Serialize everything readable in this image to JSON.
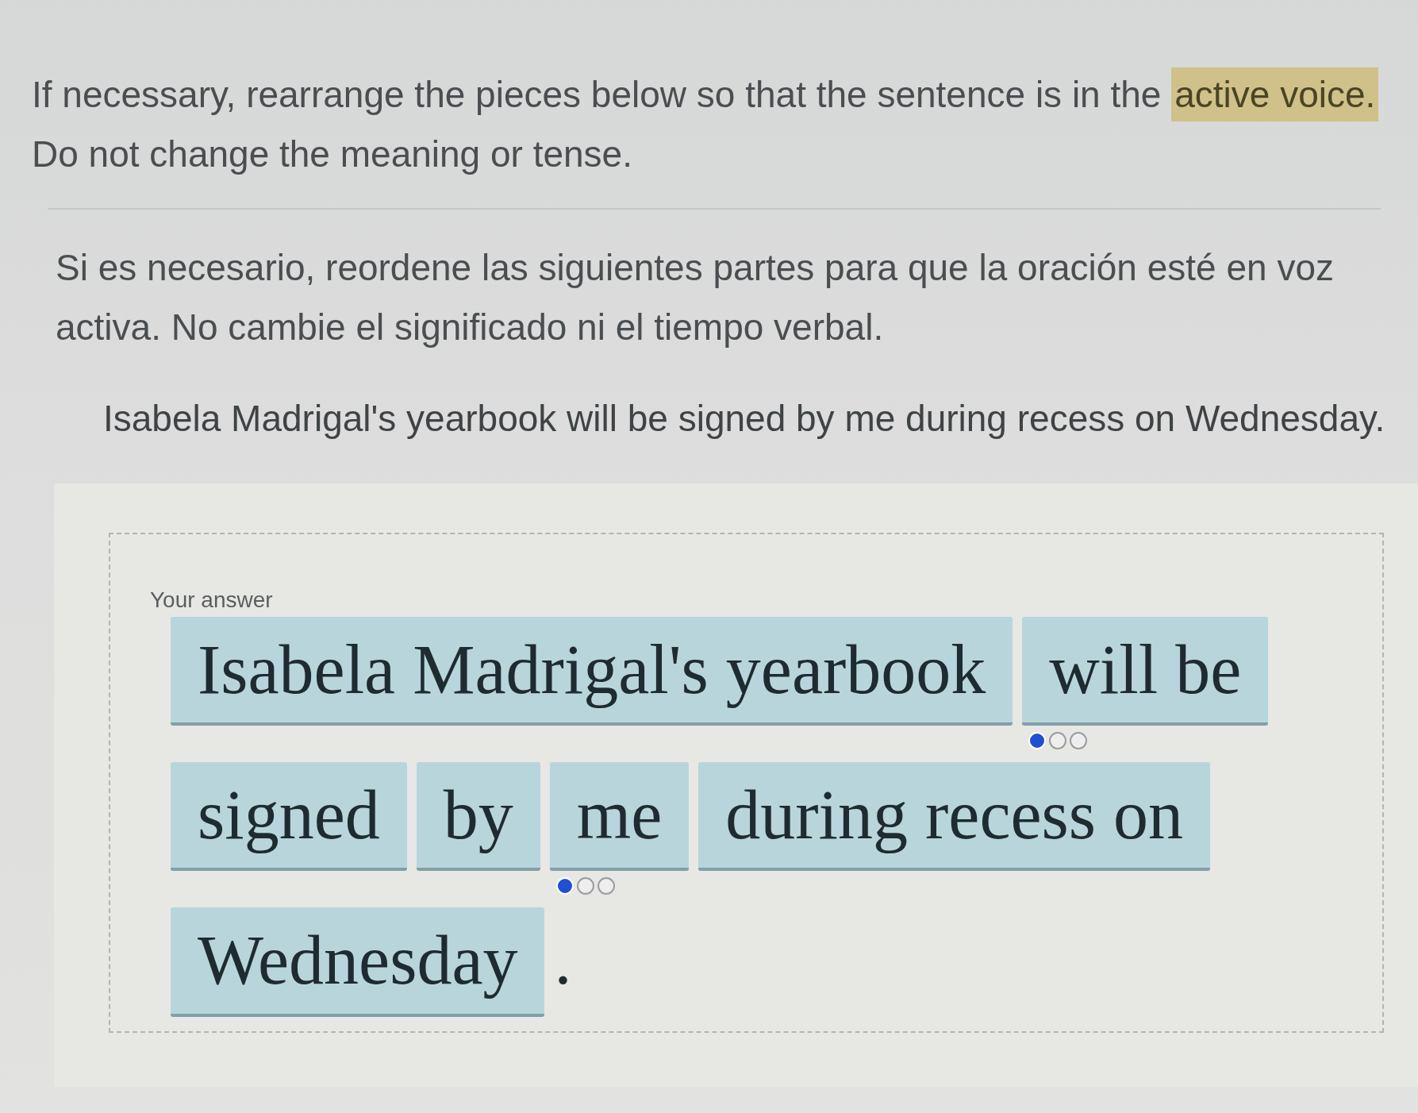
{
  "instructions_en": {
    "segments": [
      {
        "text": "If necessary, rearrange the pieces below so that the sentence is in the ",
        "highlighted": false
      },
      {
        "text": "active voice.",
        "highlighted": true
      },
      {
        "text": " Do not change the meaning or tense.",
        "highlighted": false
      }
    ]
  },
  "instructions_es": {
    "text": "Si es necesario, reordene las siguientes partes para que la oración esté en voz activa. No cambie el significado ni el tiempo verbal."
  },
  "sentence": "Isabela Madrigal's yearbook will be signed by me during recess on Wednesday.",
  "answer": {
    "label": "Your answer",
    "pieces": [
      {
        "kind": "tile",
        "text": "Isabela Madrigal's yearbook"
      },
      {
        "kind": "tile",
        "text": "will be",
        "dots": [
          {
            "selected": true
          },
          {
            "selected": false
          },
          {
            "selected": false
          }
        ]
      },
      {
        "kind": "tile",
        "text": "signed"
      },
      {
        "kind": "tile",
        "text": "by"
      },
      {
        "kind": "tile",
        "text": "me",
        "dots": [
          {
            "selected": true
          },
          {
            "selected": false
          },
          {
            "selected": false
          }
        ]
      },
      {
        "kind": "tile",
        "text": "during recess on"
      },
      {
        "kind": "tile",
        "text": "Wednesday"
      },
      {
        "kind": "punctuation",
        "text": "."
      }
    ]
  }
}
